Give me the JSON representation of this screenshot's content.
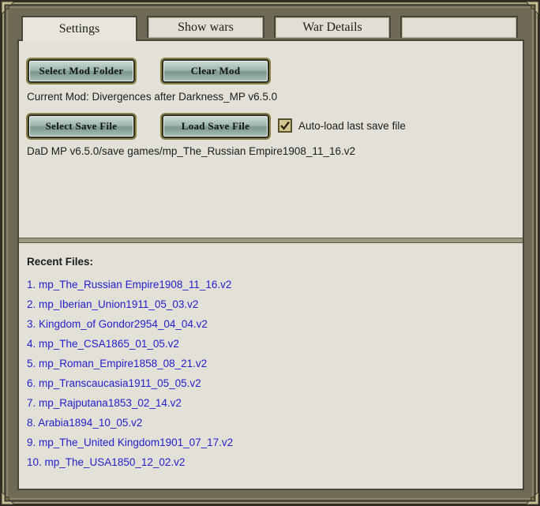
{
  "tabs": [
    {
      "label": "Settings"
    },
    {
      "label": "Show wars"
    },
    {
      "label": "War Details"
    },
    {
      "label": ""
    }
  ],
  "settings": {
    "select_mod_folder_label": "Select Mod Folder",
    "clear_mod_label": "Clear Mod",
    "current_mod_text": "Current Mod: Divergences after Darkness_MP v6.5.0",
    "select_save_file_label": "Select Save File",
    "load_save_file_label": "Load Save File",
    "auto_load_label": "Auto-load last save file",
    "auto_load_checked": true,
    "save_path_text": "DaD MP v6.5.0/save games/mp_The_Russian Empire1908_11_16.v2"
  },
  "recent": {
    "title": "Recent Files:",
    "files": [
      "1. mp_The_Russian Empire1908_11_16.v2",
      "2. mp_Iberian_Union1911_05_03.v2",
      "3. Kingdom_of Gondor2954_04_04.v2",
      "4. mp_The_CSA1865_01_05.v2",
      "5. mp_Roman_Empire1858_08_21.v2",
      "6. mp_Transcaucasia1911_05_05.v2",
      "7. mp_Rajputana1853_02_14.v2",
      "8. Arabia1894_10_05.v2",
      "9. mp_The_United Kingdom1901_07_17.v2",
      "10. mp_The_USA1850_12_02.v2"
    ]
  },
  "icons": {
    "checkbox": "checkmark-icon",
    "corners": "ornament-corner-icon"
  },
  "colors": {
    "link": "#2222cc",
    "panel": "#e3e0d8",
    "frame": "#6f6a56",
    "button": "#9fb6b0"
  }
}
